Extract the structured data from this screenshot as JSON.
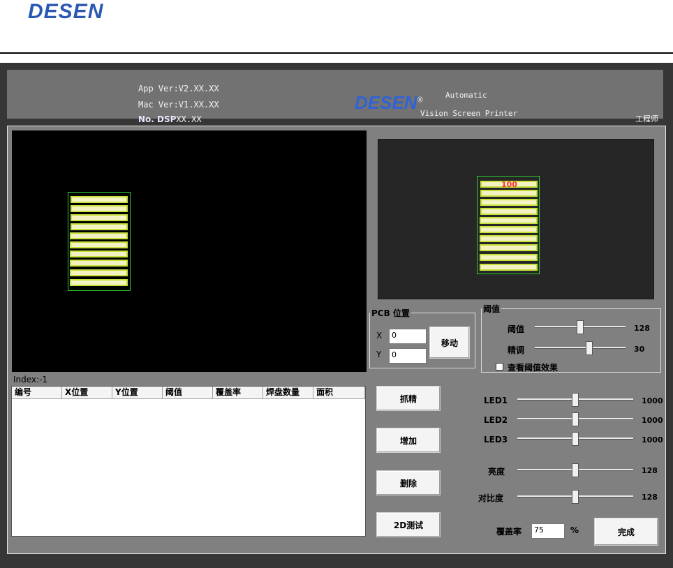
{
  "header": {
    "brand": "DESEN"
  },
  "titlebar": {
    "app_ver": "App Ver:V2.XX.XX",
    "mac_ver": "Mac Ver:V1.XX.XX",
    "dsp_label": "No. DSP",
    "dsp_ver": "XX.XX",
    "logo": "DESEN",
    "line1": "Automatic",
    "line2": "Vision Screen Printer",
    "role": "工程师"
  },
  "preview": {
    "number": "100"
  },
  "index_label": "Index:-1",
  "table": {
    "columns": [
      "编号",
      "X位置",
      "Y位置",
      "阈值",
      "覆盖率",
      "焊盘数量",
      "面积"
    ]
  },
  "pcb": {
    "legend": "PCB 位置",
    "x_label": "X",
    "x_value": "0",
    "y_label": "Y",
    "y_value": "0",
    "move_button": "移动"
  },
  "threshold": {
    "legend": "阈值",
    "threshold_label": "阈值",
    "threshold_value": "128",
    "threshold_level": 0.5,
    "fine_label": "精调",
    "fine_value": "30",
    "fine_level": 0.6,
    "check_label": "查看阈值效果",
    "checked": false
  },
  "buttons": {
    "capture": "抓精",
    "add": "增加",
    "delete": "删除",
    "test2d": "2D测试",
    "done": "完成"
  },
  "lighting": {
    "led1_label": "LED1",
    "led1_value": "1000",
    "led1_level": 0.5,
    "led2_label": "LED2",
    "led2_value": "1000",
    "led2_level": 0.5,
    "led3_label": "LED3",
    "led3_value": "1000",
    "led3_level": 0.5,
    "brightness_label": "亮度",
    "brightness_value": "128",
    "brightness_level": 0.5,
    "contrast_label": "对比度",
    "contrast_value": "128",
    "contrast_level": 0.5
  },
  "coverage": {
    "label": "覆盖率",
    "value": "75",
    "unit": "%"
  },
  "colors": {
    "pad_outline": "#2ecc2e",
    "pad_fill": "#f4f2c4",
    "preview_number": "#ff3030",
    "brand_blue": "#2b58b3"
  }
}
